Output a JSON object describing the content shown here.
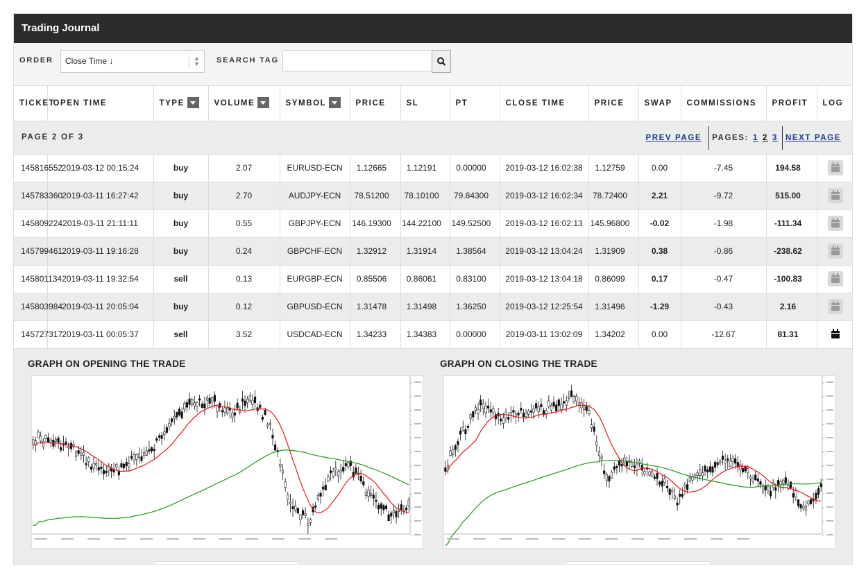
{
  "app": {
    "title": "Trading Journal"
  },
  "controls": {
    "order_label": "ORDER",
    "order_value": "Close Time ↓",
    "search_label": "SEARCH TAG",
    "search_placeholder": ""
  },
  "table": {
    "headers": [
      "TICKET",
      "OPEN TIME",
      "TYPE",
      "VOLUME",
      "SYMBOL",
      "PRICE",
      "SL",
      "PT",
      "CLOSE TIME",
      "PRICE",
      "SWAP",
      "COMMISSIONS",
      "PROFIT",
      "LOG"
    ],
    "rows": [
      {
        "ticket": "145816552",
        "open_time": "2019-03-12 00:15:24",
        "type": "buy",
        "volume": "2.07",
        "symbol": "EURUSD-ECN",
        "price": "1.12665",
        "sl": "1.12191",
        "pt": "0.00000",
        "close_time": "2019-03-12 16:02:38",
        "close_price": "1.12759",
        "swap": "0.00",
        "commissions": "-7.45",
        "profit": "194.58"
      },
      {
        "ticket": "145783360",
        "open_time": "2019-03-11 16:27:42",
        "type": "buy",
        "volume": "2.70",
        "symbol": "AUDJPY-ECN",
        "price": "78.51200",
        "sl": "78.10100",
        "pt": "79.84300",
        "close_time": "2019-03-12 16:02:34",
        "close_price": "78.72400",
        "swap": "2.21",
        "commissions": "-9.72",
        "profit": "515.00"
      },
      {
        "ticket": "145809224",
        "open_time": "2019-03-11 21:11:11",
        "type": "buy",
        "volume": "0.55",
        "symbol": "GBPJPY-ECN",
        "price": "146.19300",
        "sl": "144.22100",
        "pt": "149.52500",
        "close_time": "2019-03-12 16:02:13",
        "close_price": "145.96800",
        "swap": "-0.02",
        "commissions": "-1.98",
        "profit": "-111.34"
      },
      {
        "ticket": "145799461",
        "open_time": "2019-03-11 19:16:28",
        "type": "buy",
        "volume": "0.24",
        "symbol": "GBPCHF-ECN",
        "price": "1.32912",
        "sl": "1.31914",
        "pt": "1.38564",
        "close_time": "2019-03-12 13:04:24",
        "close_price": "1.31909",
        "swap": "0.38",
        "commissions": "-0.86",
        "profit": "-238.62"
      },
      {
        "ticket": "145801134",
        "open_time": "2019-03-11 19:32:54",
        "type": "sell",
        "volume": "0.13",
        "symbol": "EURGBP-ECN",
        "price": "0.85506",
        "sl": "0.86061",
        "pt": "0.83100",
        "close_time": "2019-03-12 13:04:18",
        "close_price": "0.86099",
        "swap": "0.17",
        "commissions": "-0.47",
        "profit": "-100.83"
      },
      {
        "ticket": "145803984",
        "open_time": "2019-03-11 20:05:04",
        "type": "buy",
        "volume": "0.12",
        "symbol": "GBPUSD-ECN",
        "price": "1.31478",
        "sl": "1.31498",
        "pt": "1.36250",
        "close_time": "2019-03-12 12:25:54",
        "close_price": "1.31496",
        "swap": "-1.29",
        "commissions": "-0.43",
        "profit": "2.16"
      },
      {
        "ticket": "145727317",
        "open_time": "2019-03-11 00:05:37",
        "type": "sell",
        "volume": "3.52",
        "symbol": "USDCAD-ECN",
        "price": "1.34233",
        "sl": "1.34383",
        "pt": "0.00000",
        "close_time": "2019-03-11 13:02:09",
        "close_price": "1.34202",
        "swap": "0.00",
        "commissions": "-12.67",
        "profit": "81.31"
      }
    ]
  },
  "pagination": {
    "info": "PAGE 2 OF 3",
    "prev_label": "PREV PAGE",
    "pages_label": "PAGES:",
    "pages": [
      "1",
      "2",
      "3"
    ],
    "current_page": "2",
    "next_label": "NEXT PAGE"
  },
  "graphs": {
    "opening_title": "GRAPH ON OPENING THE TRADE",
    "closing_title": "GRAPH ON CLOSING THE TRADE"
  },
  "colors": {
    "header_bg": "#2b2b2b",
    "buy": "#3dae2b",
    "sell": "#d8163a",
    "link": "#1a3a8a",
    "ma_fast": "#e8141a",
    "ma_slow": "#1a9a1a"
  },
  "icons": {
    "search": "search-icon",
    "log": "calendar-icon",
    "sort": "chevron-down-icon"
  }
}
